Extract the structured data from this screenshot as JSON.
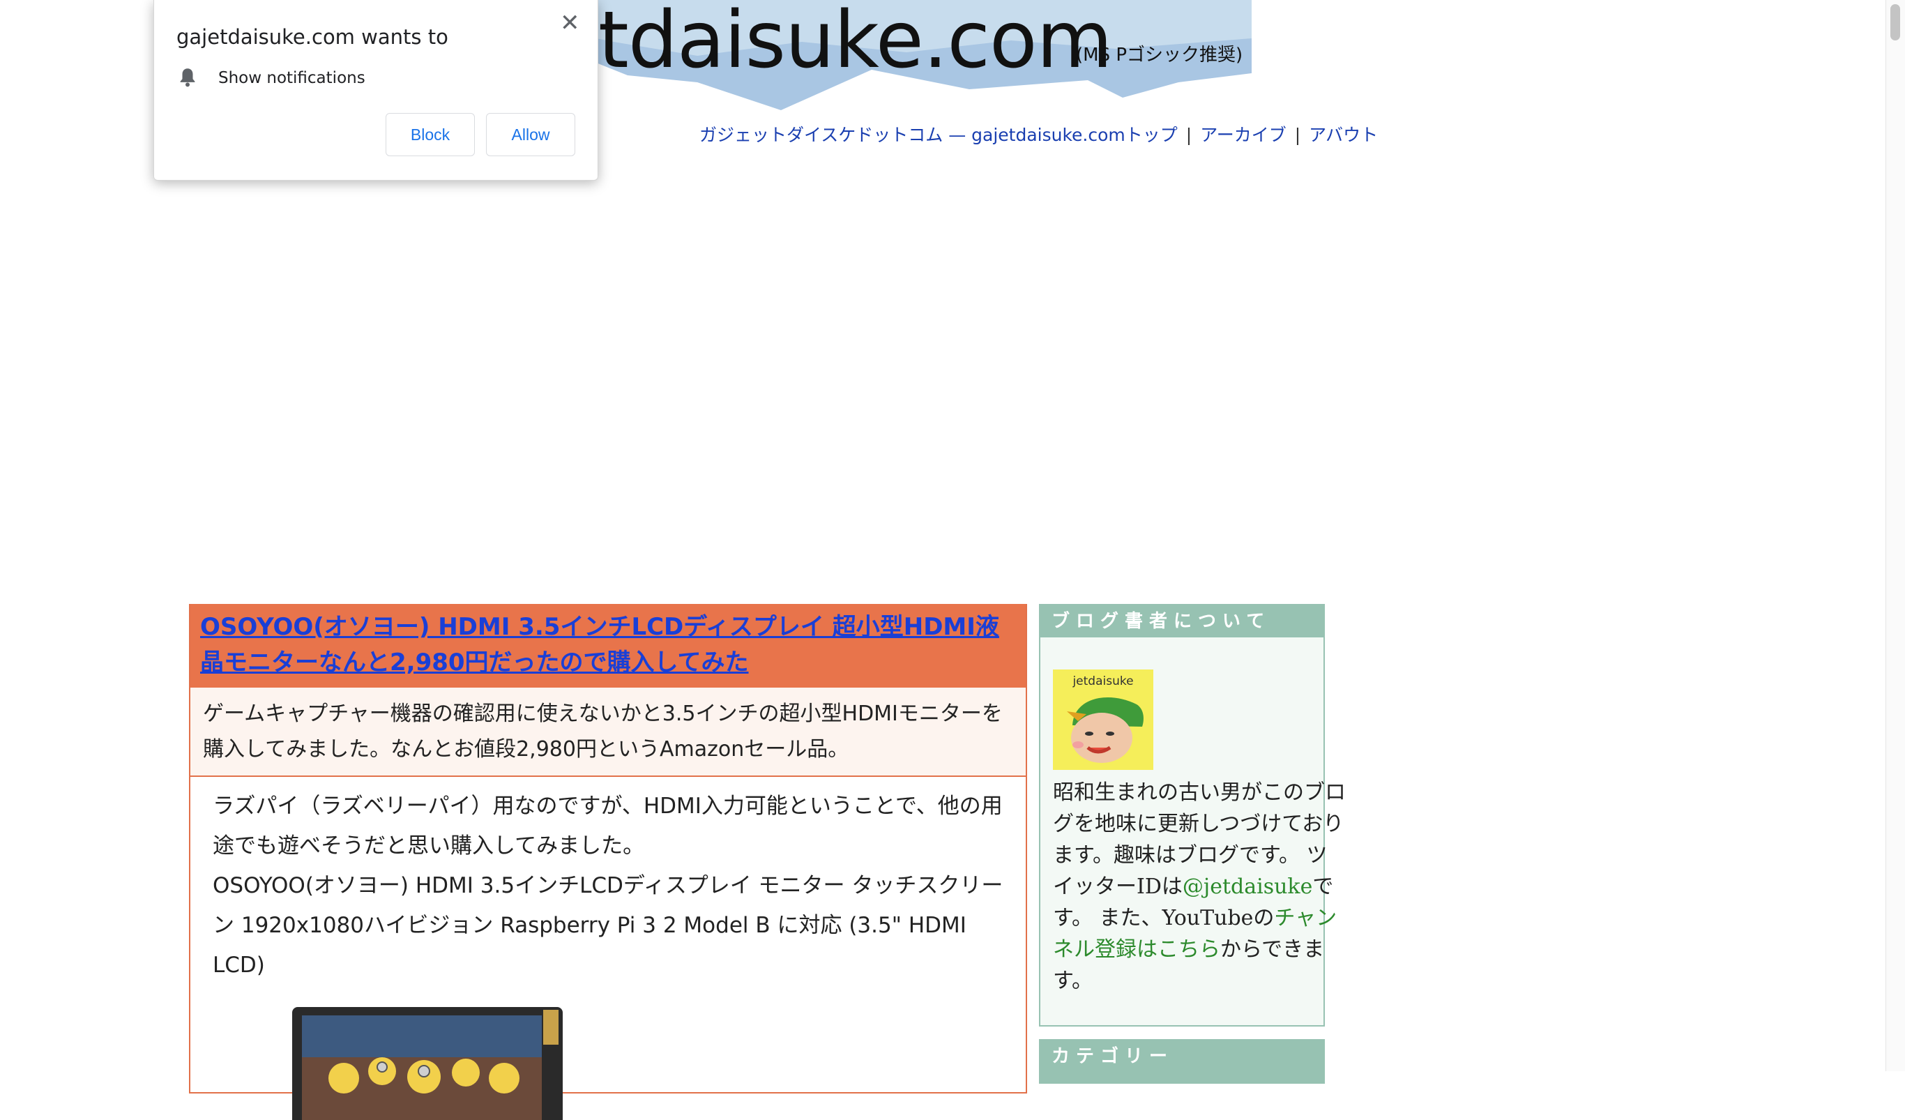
{
  "banner": {
    "title": "etdaisuke.com",
    "note": "(MS Pゴシック推奨)"
  },
  "nav": {
    "site_name": "ガジェットダイスケドットコム — gajetdaisuke.comトップ",
    "sep1": "|",
    "archive": "アーカイブ",
    "sep2": "|",
    "about": "アバウト"
  },
  "popup": {
    "title": "gajetdaisuke.com wants to",
    "permission": "Show notifications",
    "block": "Block",
    "allow": "Allow",
    "close_glyph": "✕"
  },
  "article": {
    "title": "OSOYOO(オソヨー) HDMI 3.5インチLCDディスプレイ 超小型HDMI液晶モニターなんと2,980円だったので購入してみた",
    "summary": "ゲームキャプチャー機器の確認用に使えないかと3.5インチの超小型HDMIモニターを購入してみました。なんとお値段2,980円というAmazonセール品。",
    "para1": "ラズパイ（ラズベリーパイ）用なのですが、HDMI入力可能ということで、他の用途でも遊べそうだと思い購入してみました。",
    "para2": "OSOYOO(オソヨー) HDMI 3.5インチLCDディスプレイ モニター タッチスクリーン 1920x1080ハイビジョン Raspberry Pi 3 2 Model B に対応 (3.5\" HDMI LCD)"
  },
  "sidebar": {
    "about_heading": "ブログ書者について",
    "avatar_label": "jetdaisuke",
    "bio_1": "昭和生まれの古い男がこのブログを地味に更新しつづけております。趣味はブログです。 ツイッターIDは",
    "twitter": "@jetdaisuke",
    "bio_2": "です。 また、YouTubeの",
    "channel_link": "チャンネル登録はこちら",
    "bio_3": "からできます。",
    "category_heading": "カテゴリー"
  },
  "colors": {
    "article_accent": "#e8744b",
    "sidebar_accent": "#97c2b2",
    "link_blue": "#1a3fd6",
    "link_green": "#2c8a2c"
  }
}
